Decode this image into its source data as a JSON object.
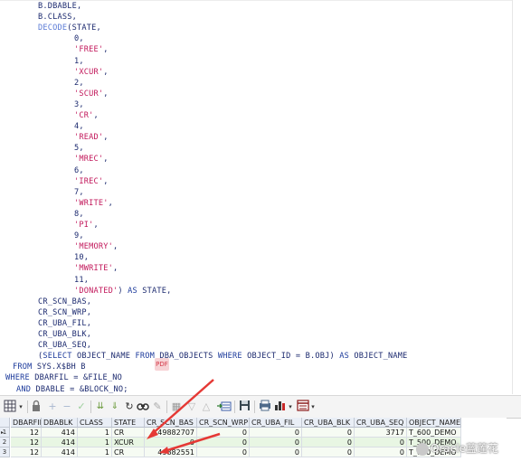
{
  "editor": {
    "lines": [
      {
        "indent": 42,
        "parts": [
          {
            "t": "B.DBABLE,",
            "c": "code"
          }
        ]
      },
      {
        "indent": 42,
        "parts": [
          {
            "t": "B.CLASS,",
            "c": "code"
          }
        ]
      },
      {
        "indent": 42,
        "parts": [
          {
            "t": "DECODE",
            "c": "func"
          },
          {
            "t": "(STATE,",
            "c": "code"
          }
        ]
      },
      {
        "indent": 82,
        "parts": [
          {
            "t": "0,",
            "c": "code"
          }
        ]
      },
      {
        "indent": 82,
        "parts": [
          {
            "t": "'FREE'",
            "c": "str"
          },
          {
            "t": ",",
            "c": "code"
          }
        ]
      },
      {
        "indent": 82,
        "parts": [
          {
            "t": "1,",
            "c": "code"
          }
        ]
      },
      {
        "indent": 82,
        "parts": [
          {
            "t": "'XCUR'",
            "c": "str"
          },
          {
            "t": ",",
            "c": "code"
          }
        ]
      },
      {
        "indent": 82,
        "parts": [
          {
            "t": "2,",
            "c": "code"
          }
        ]
      },
      {
        "indent": 82,
        "parts": [
          {
            "t": "'SCUR'",
            "c": "str"
          },
          {
            "t": ",",
            "c": "code"
          }
        ]
      },
      {
        "indent": 82,
        "parts": [
          {
            "t": "3,",
            "c": "code"
          }
        ]
      },
      {
        "indent": 82,
        "parts": [
          {
            "t": "'CR'",
            "c": "str"
          },
          {
            "t": ",",
            "c": "code"
          }
        ]
      },
      {
        "indent": 82,
        "parts": [
          {
            "t": "4,",
            "c": "code"
          }
        ]
      },
      {
        "indent": 82,
        "parts": [
          {
            "t": "'READ'",
            "c": "str"
          },
          {
            "t": ",",
            "c": "code"
          }
        ]
      },
      {
        "indent": 82,
        "parts": [
          {
            "t": "5,",
            "c": "code"
          }
        ]
      },
      {
        "indent": 82,
        "parts": [
          {
            "t": "'MREC'",
            "c": "str"
          },
          {
            "t": ",",
            "c": "code"
          }
        ]
      },
      {
        "indent": 82,
        "parts": [
          {
            "t": "6,",
            "c": "code"
          }
        ]
      },
      {
        "indent": 82,
        "parts": [
          {
            "t": "'IREC'",
            "c": "str"
          },
          {
            "t": ",",
            "c": "code"
          }
        ]
      },
      {
        "indent": 82,
        "parts": [
          {
            "t": "7,",
            "c": "code"
          }
        ]
      },
      {
        "indent": 82,
        "parts": [
          {
            "t": "'WRITE'",
            "c": "str"
          },
          {
            "t": ",",
            "c": "code"
          }
        ]
      },
      {
        "indent": 82,
        "parts": [
          {
            "t": "8,",
            "c": "code"
          }
        ]
      },
      {
        "indent": 82,
        "parts": [
          {
            "t": "'PI'",
            "c": "str"
          },
          {
            "t": ",",
            "c": "code"
          }
        ]
      },
      {
        "indent": 82,
        "parts": [
          {
            "t": "9,",
            "c": "code"
          }
        ]
      },
      {
        "indent": 82,
        "parts": [
          {
            "t": "'MEMORY'",
            "c": "str"
          },
          {
            "t": ",",
            "c": "code"
          }
        ]
      },
      {
        "indent": 82,
        "parts": [
          {
            "t": "10,",
            "c": "code"
          }
        ]
      },
      {
        "indent": 82,
        "parts": [
          {
            "t": "'MWRITE'",
            "c": "str"
          },
          {
            "t": ",",
            "c": "code"
          }
        ]
      },
      {
        "indent": 82,
        "parts": [
          {
            "t": "11,",
            "c": "code"
          }
        ]
      },
      {
        "indent": 82,
        "parts": [
          {
            "t": "'DONATED'",
            "c": "str"
          },
          {
            "t": ") ",
            "c": "code"
          },
          {
            "t": "AS",
            "c": "kw"
          },
          {
            "t": " STATE,",
            "c": "code"
          }
        ]
      },
      {
        "indent": 42,
        "parts": [
          {
            "t": "CR_SCN_BAS,",
            "c": "code"
          }
        ]
      },
      {
        "indent": 42,
        "parts": [
          {
            "t": "CR_SCN_WRP,",
            "c": "code"
          }
        ]
      },
      {
        "indent": 42,
        "parts": [
          {
            "t": "CR_UBA_FIL,",
            "c": "code"
          }
        ]
      },
      {
        "indent": 42,
        "parts": [
          {
            "t": "CR_UBA_BLK,",
            "c": "code"
          }
        ]
      },
      {
        "indent": 42,
        "parts": [
          {
            "t": "CR_UBA_SEQ,",
            "c": "code"
          }
        ]
      },
      {
        "indent": 42,
        "parts": [
          {
            "t": "(",
            "c": "code"
          },
          {
            "t": "SELECT",
            "c": "kw"
          },
          {
            "t": " OBJECT_NAME ",
            "c": "code"
          },
          {
            "t": "FROM",
            "c": "kw"
          },
          {
            "t": " DBA_OBJECTS ",
            "c": "code"
          },
          {
            "t": "WHERE",
            "c": "kw"
          },
          {
            "t": " OBJECT_ID = B.OBJ) ",
            "c": "code"
          },
          {
            "t": "AS",
            "c": "kw"
          },
          {
            "t": " OBJECT_NAME",
            "c": "code"
          }
        ]
      },
      {
        "indent": 14,
        "parts": [
          {
            "t": "FROM",
            "c": "kw"
          },
          {
            "t": " SYS.X$BH B",
            "c": "code"
          }
        ]
      },
      {
        "indent": 6,
        "parts": [
          {
            "t": "WHERE",
            "c": "kw"
          },
          {
            "t": " DBARFIL = &FILE_NO",
            "c": "code"
          }
        ]
      },
      {
        "indent": 18,
        "parts": [
          {
            "t": "AND",
            "c": "kw"
          },
          {
            "t": " DBABLE = &BLOCK_NO;",
            "c": "code"
          }
        ]
      }
    ]
  },
  "toolbar": {
    "icons": [
      "grid-view-icon",
      "dropdown-arrow-icon",
      "lock-icon",
      "add-row-icon",
      "delete-row-icon",
      "post-edit-icon",
      "fetch-next-icon",
      "fetch-last-icon",
      "refresh-icon",
      "find-icon",
      "clear-icon",
      "query-by-example-icon",
      "filter-icon",
      "sort-icon",
      "export-icon",
      "save-icon",
      "print-icon",
      "chart-icon",
      "dropdown-arrow-icon",
      "record-view-icon",
      "dropdown-arrow-icon"
    ]
  },
  "grid": {
    "columns": [
      "DBARFIL",
      "DBABLK",
      "CLASS",
      "STATE",
      "CR_SCN_BAS",
      "CR_SCN_WRP",
      "CR_UBA_FIL",
      "CR_UBA_BLK",
      "CR_UBA_SEQ",
      "OBJECT_NAME"
    ],
    "rows": [
      {
        "num": "1",
        "DBARFIL": "12",
        "DBABLK": "414",
        "CLASS": "1",
        "STATE": "CR",
        "CR_SCN_BAS": "49882707",
        "CR_SCN_WRP": "0",
        "CR_UBA_FIL": "0",
        "CR_UBA_BLK": "0",
        "CR_UBA_SEQ": "3717",
        "OBJECT_NAME": "T_600_DEMO"
      },
      {
        "num": "2",
        "DBARFIL": "12",
        "DBABLK": "414",
        "CLASS": "1",
        "STATE": "XCUR",
        "CR_SCN_BAS": "0",
        "CR_SCN_WRP": "0",
        "CR_UBA_FIL": "0",
        "CR_UBA_BLK": "0",
        "CR_UBA_SEQ": "0",
        "OBJECT_NAME": "T_500_DEMO"
      },
      {
        "num": "3",
        "DBARFIL": "12",
        "DBABLK": "414",
        "CLASS": "1",
        "STATE": "CR",
        "CR_SCN_BAS": "49882551",
        "CR_SCN_WRP": "0",
        "CR_UBA_FIL": "0",
        "CR_UBA_BLK": "0",
        "CR_UBA_SEQ": "0",
        "OBJECT_NAME": "T_600_DEMO"
      }
    ]
  },
  "watermark": {
    "text": "Oracle蓝莲花"
  },
  "colors": {
    "arrow": "#e53935",
    "keyword": "#1d3b9c",
    "string": "#c2185b"
  }
}
